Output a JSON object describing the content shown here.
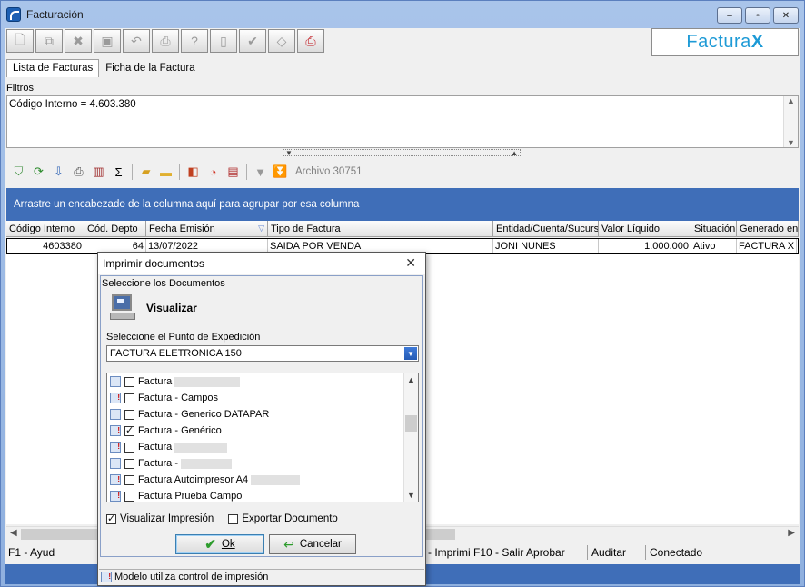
{
  "window": {
    "title": "Facturación",
    "controls": {
      "minimize": "–",
      "maximize": "▫",
      "close": "✕"
    }
  },
  "brand": {
    "text": "Factura ",
    "x": "X"
  },
  "tabs": [
    {
      "label": "Lista de Facturas",
      "active": true
    },
    {
      "label": "Ficha de la Factura",
      "active": false
    }
  ],
  "filters": {
    "label": "Filtros",
    "text": "Código Interno = 4.603.380"
  },
  "toolbar2": {
    "archivo": "Archivo 30751"
  },
  "grid": {
    "group_hint": "Arrastre un encabezado de la columna aquí para agrupar por esa columna",
    "columns": [
      "Código Interno",
      "Cód. Depto",
      "Fecha Emisión",
      "Tipo de Factura",
      "Entidad/Cuenta/Sucursal",
      "Valor Líquido",
      "Situación",
      "Generado en"
    ],
    "row": [
      "4603380",
      "64",
      "13/07/2022",
      "SAIDA POR VENDA",
      "JONI NUNES",
      "1.000.000",
      "Ativo",
      "FACTURA X"
    ]
  },
  "statusbar": {
    "f1": "F1 - Ayud",
    "middle": "- Imprimi F10 - Salir Aprobar",
    "auditar": "Auditar",
    "conectado": "Conectado"
  },
  "dialog": {
    "title": "Imprimir documentos",
    "close": "✕",
    "subtitle": "Seleccione los Documentos",
    "heading": "Visualizar",
    "punto_label": "Seleccione el Punto de Expedición",
    "punto_value": "FACTURA ELETRONICA 150",
    "documents": [
      {
        "label": "Factura",
        "checked": false,
        "warn": false
      },
      {
        "label": "Factura - Campos",
        "checked": false,
        "warn": true
      },
      {
        "label": "Factura - Generico DATAPAR",
        "checked": false,
        "warn": false
      },
      {
        "label": "Factura - Genérico",
        "checked": true,
        "warn": true
      },
      {
        "label": "Factura",
        "checked": false,
        "warn": true
      },
      {
        "label": "Factura -",
        "checked": false,
        "warn": false
      },
      {
        "label": "Factura Autoimpresor A4",
        "checked": false,
        "warn": true
      },
      {
        "label": "Factura Prueba Campo",
        "checked": false,
        "warn": true
      }
    ],
    "opt_visualizar": "Visualizar Impresión",
    "opt_exportar": "Exportar Documento",
    "ok": "Ok",
    "cancel": "Cancelar",
    "status": "Modelo utiliza control de impresión"
  }
}
